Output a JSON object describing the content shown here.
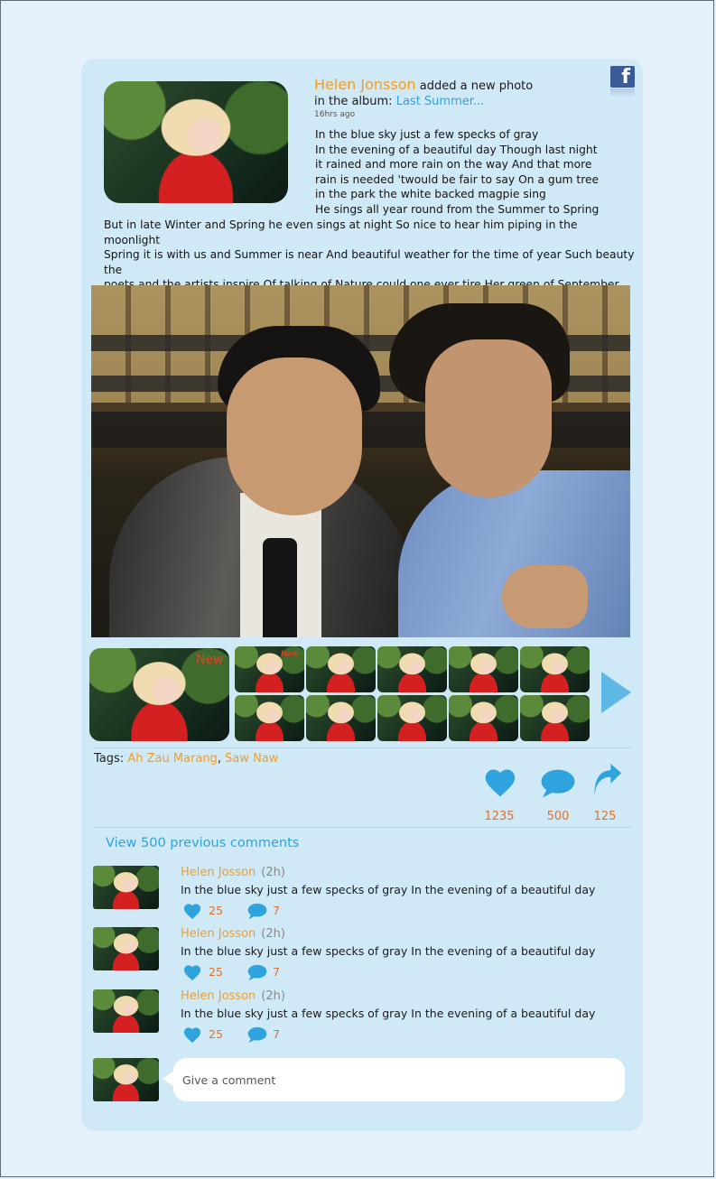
{
  "post": {
    "author": "Helen Jonsson",
    "action": "added a new photo",
    "album_prefix": "in the album:",
    "album_link": "Last Summer...",
    "time": "16hrs ago",
    "poem_narrow": "In the blue sky just a few specks of gray\nIn the evening of a beautiful day Though last night\nit rained and more rain on the way And that more\nrain is needed 'twould be fair to say On a gum tree\nin the park the white backed magpie sing\nHe sings all year round from the Summer to Spring",
    "poem_wide": "But in late Winter and Spring he even sings at night So nice to hear him piping in the moonlight\nSpring it is with us and Summer is near And beautiful weather for the time of year Such beauty the\npoets and the artists inspire Of talking of Nature could one ever tire Her green of September Mother\nNature wear And the perfumes of blossoms in the evening air."
  },
  "gallery": {
    "new_label": "New",
    "new_label_small": "New"
  },
  "tags": {
    "label": "Tags:",
    "items": [
      "Ah Zau Marang",
      "Saw Naw"
    ],
    "separator": ","
  },
  "stats": {
    "likes": "1235",
    "comments": "500",
    "shares": "125"
  },
  "comments_section": {
    "view_previous": "View 500 previous comments",
    "items": [
      {
        "name": "Helen Josson",
        "time": "(2h)",
        "text": "In the blue sky just a few specks of gray In the evening of a beautiful day",
        "likes": "25",
        "comments": "7"
      },
      {
        "name": "Helen Josson",
        "time": "(2h)",
        "text": "In the blue sky just a few specks of gray In the evening of a beautiful day",
        "likes": "25",
        "comments": "7"
      },
      {
        "name": "Helen Josson",
        "time": "(2h)",
        "text": "In the blue sky just a few specks of gray In the evening of a beautiful day",
        "likes": "25",
        "comments": "7"
      }
    ],
    "input_placeholder": "Give a comment"
  },
  "icons": {
    "brand": "facebook-icon",
    "like": "heart-icon",
    "comment": "speech-bubble-icon",
    "share": "share-arrow-icon",
    "next": "next-arrow-icon"
  },
  "colors": {
    "accent_blue": "#2ea3de",
    "author_orange": "#f39c23",
    "count_orange": "#e0712e",
    "card": "#d0e9f6",
    "page": "#e4f1fa"
  }
}
